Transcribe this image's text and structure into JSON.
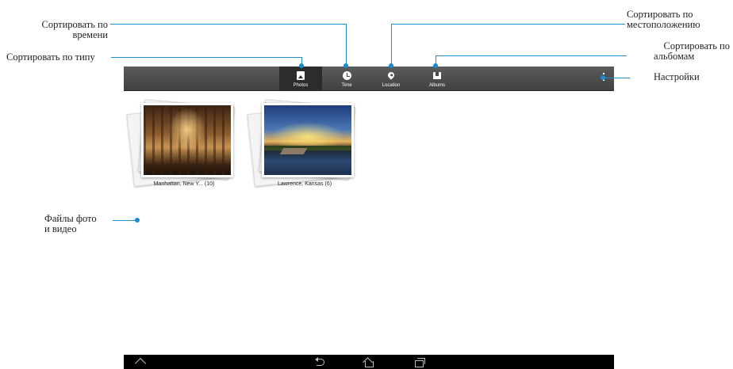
{
  "tabs": [
    {
      "label": "Photos",
      "icon": "photos-icon",
      "active": true
    },
    {
      "label": "Time",
      "icon": "clock-icon",
      "active": false
    },
    {
      "label": "Location",
      "icon": "location-pin-icon",
      "active": false
    },
    {
      "label": "Albums",
      "icon": "albums-icon",
      "active": false
    }
  ],
  "albums": [
    {
      "caption": "Manhattan, New Y... (10)"
    },
    {
      "caption": "Lawrence, Kansas (6)"
    }
  ],
  "callouts": {
    "sort_time_1": "Сортировать по",
    "sort_time_2": "времени",
    "sort_type": "Сортировать по типу",
    "sort_location_1": "Сортировать по",
    "sort_location_2": "местоположению",
    "sort_albums_1": "Сортировать по",
    "sort_albums_2": "альбомам",
    "settings": "Настройки",
    "files_1": "Файлы  фото",
    "files_2": "и видео"
  },
  "colors": {
    "callout": "#1a8bd0",
    "toolbar": "#494949",
    "active_tab": "#2c2c2c"
  }
}
